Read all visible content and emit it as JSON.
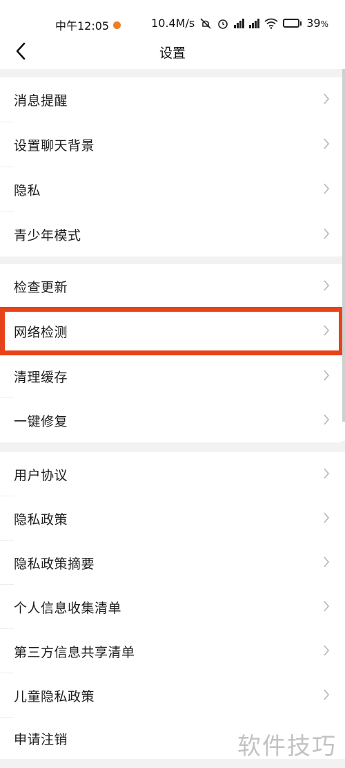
{
  "status_bar": {
    "time": "中午12:05",
    "speed": "10.4M/s",
    "battery": "39",
    "battery_unit": "%",
    "battery_level": 0.39,
    "icons": [
      "notification-dot-icon",
      "mute-icon",
      "alarm-icon",
      "signal-icon",
      "signal-icon",
      "wifi-icon",
      "battery-icon"
    ]
  },
  "header": {
    "title": "设置",
    "back_icon": "chevron-left-icon"
  },
  "settings": {
    "group1": [
      {
        "label": "消息提醒"
      },
      {
        "label": "设置聊天背景"
      },
      {
        "label": "隐私"
      },
      {
        "label": "青少年模式"
      }
    ],
    "group2": [
      {
        "label": "检查更新"
      },
      {
        "label": "网络检测"
      },
      {
        "label": "清理缓存"
      },
      {
        "label": "一键修复"
      }
    ],
    "group3": [
      {
        "label": "用户协议"
      },
      {
        "label": "隐私政策"
      },
      {
        "label": "隐私政策摘要"
      },
      {
        "label": "个人信息收集清单"
      },
      {
        "label": "第三方信息共享清单"
      },
      {
        "label": "儿童隐私政策"
      },
      {
        "label": "申请注销"
      }
    ],
    "highlighted_item": "网络检测"
  },
  "colors": {
    "highlight": "#e84218",
    "section_gap": "#f2f2f2",
    "chevron": "#b5b5b5"
  },
  "watermark": "软件技巧"
}
